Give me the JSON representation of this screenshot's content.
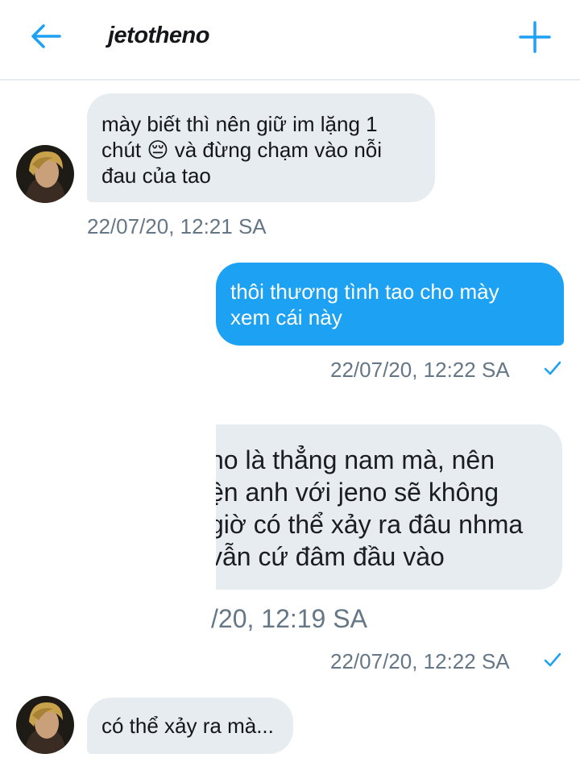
{
  "header": {
    "title": "jetotheno",
    "back_icon": "arrow-left-icon",
    "add_icon": "plus-icon",
    "accent_color": "#1da1f2"
  },
  "messages": [
    {
      "direction": "incoming",
      "lines": [
        "mày biết thì nên giữ im lặng 1",
        "chút 😔 và đừng chạm vào nỗi",
        "đau của tao"
      ],
      "timestamp": "22/07/20, 12:21 SA"
    },
    {
      "direction": "outgoing",
      "lines": [
        "thôi thương tình tao cho mày",
        "xem cái này"
      ],
      "timestamp": "22/07/20, 12:22 SA",
      "status_icon": "check-icon"
    },
    {
      "direction": "outgoing",
      "type": "shared-screenshot",
      "shared_lines": [
        "no là thẳng nam mà, nên",
        "ện anh với jeno sẽ không",
        "giờ có thể xảy ra đâu nhma",
        "vẫn cứ đâm đầu vào"
      ],
      "shared_timestamp": "/20, 12:19 SA",
      "timestamp": "22/07/20, 12:22 SA",
      "status_icon": "check-icon"
    },
    {
      "direction": "incoming",
      "lines": [
        "có thể xảy ra mà..."
      ]
    }
  ],
  "colors": {
    "incoming_bubble": "#e6ecf0",
    "outgoing_bubble": "#1da1f2",
    "timestamp": "#657786"
  }
}
